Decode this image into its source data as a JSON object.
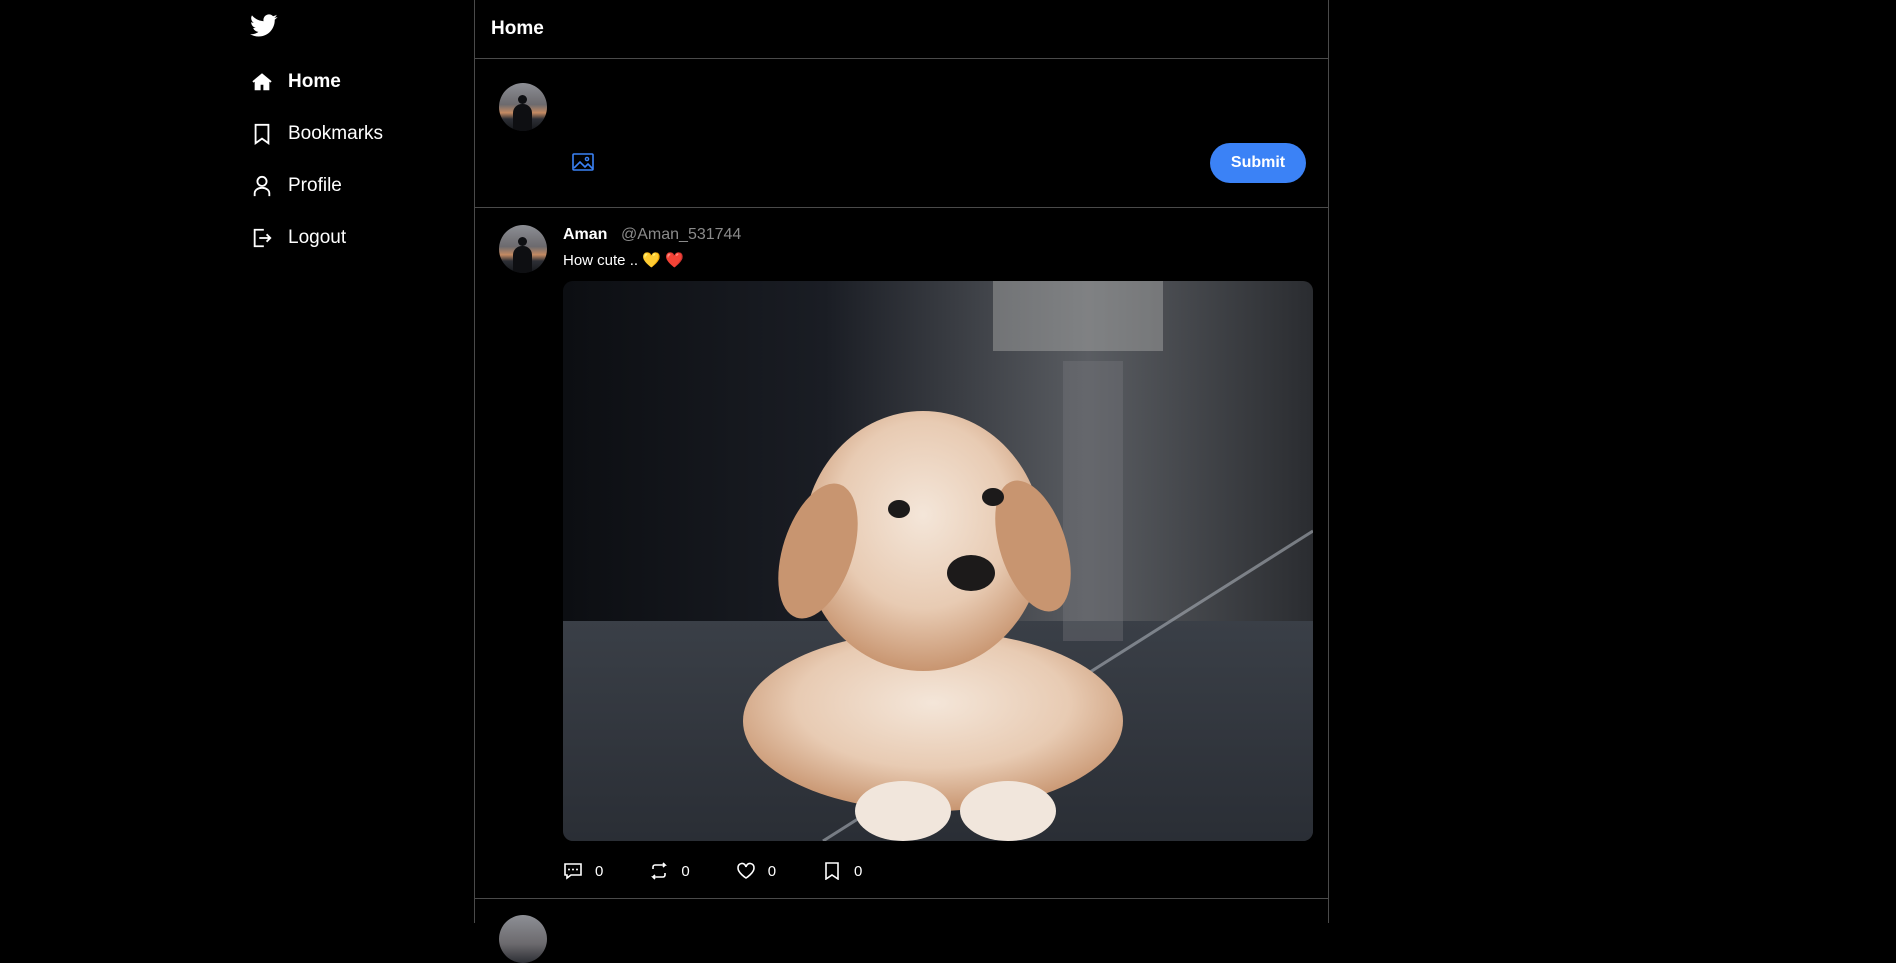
{
  "nav": {
    "items": [
      {
        "label": "Home",
        "icon": "home-icon",
        "active": true
      },
      {
        "label": "Bookmarks",
        "icon": "bookmark-icon",
        "active": false
      },
      {
        "label": "Profile",
        "icon": "user-icon",
        "active": false
      },
      {
        "label": "Logout",
        "icon": "logout-icon",
        "active": false
      }
    ]
  },
  "header": {
    "title": "Home"
  },
  "composer": {
    "placeholder": "",
    "submit_label": "Submit"
  },
  "tweet": {
    "name": "Aman",
    "handle": "@Aman_531744",
    "text": "How cute ..",
    "emojis": [
      "💛",
      "❤️"
    ],
    "stats": {
      "comments": "0",
      "retweets": "0",
      "likes": "0",
      "bookmarks": "0"
    }
  },
  "colors": {
    "accent": "#3b82f6",
    "background": "#000000",
    "border": "#4a4a4a",
    "muted": "#8a8a8a"
  }
}
